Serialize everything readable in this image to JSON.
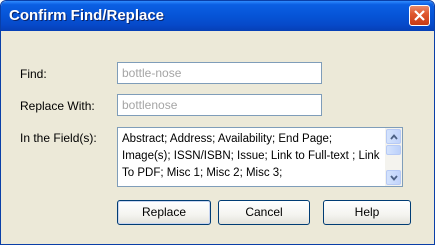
{
  "dialog": {
    "title": "Confirm Find/Replace",
    "close_icon": "close-icon"
  },
  "form": {
    "find_label": "Find:",
    "find_value": "bottle-nose",
    "replace_label": "Replace With:",
    "replace_value": "bottlenose",
    "fields_label": "In the Field(s):",
    "fields_value": "Abstract; Address; Availability; End Page; Image(s); ISSN/ISBN; Issue; Link to Full-text ; Link To PDF; Misc 1; Misc 2; Misc 3;"
  },
  "buttons": {
    "replace": "Replace",
    "cancel": "Cancel",
    "help": "Help"
  },
  "colors": {
    "title_bar": "#0654d6",
    "close_button": "#e0582f",
    "dialog_bg": "#ece9d8",
    "disabled_text": "#a5a5a5"
  }
}
